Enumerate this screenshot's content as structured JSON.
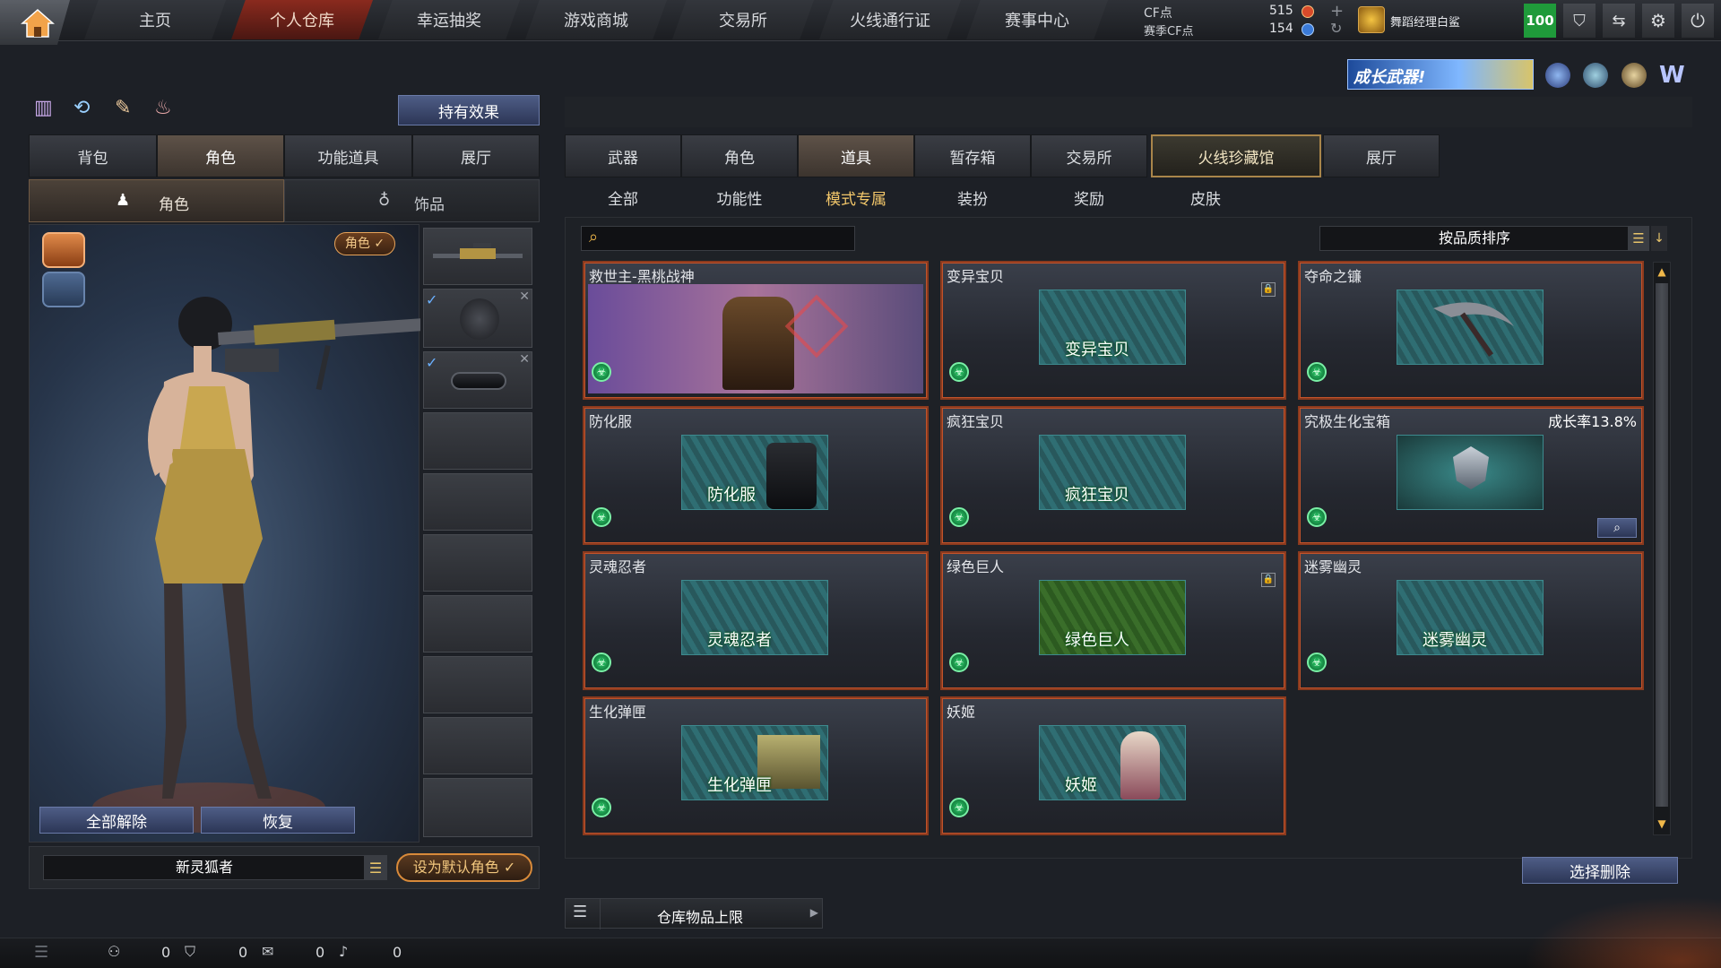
{
  "nav": {
    "items": [
      "主页",
      "个人仓库",
      "幸运抽奖",
      "游戏商城",
      "交易所",
      "火线通行证",
      "赛事中心"
    ],
    "active_index": 1
  },
  "currency": {
    "cf_label": "CF点",
    "cf_value": "515",
    "season_cf_label": "赛季CF点",
    "season_cf_value": "154"
  },
  "user": {
    "name": "舞蹈经理白鲨",
    "level": "100"
  },
  "banner": {
    "text": "成长武器!"
  },
  "left": {
    "effects_button": "持有效果",
    "tabs": [
      "背包",
      "角色",
      "功能道具",
      "展厅"
    ],
    "selected_tab": 1,
    "subtabs": [
      "角色",
      "饰品"
    ],
    "character_badge": "角色 ✓",
    "unequip_all": "全部解除",
    "restore": "恢复",
    "character_name": "新灵狐者",
    "set_default": "设为默认角色 ✓"
  },
  "right": {
    "tabs": [
      "武器",
      "角色",
      "道具",
      "暂存箱",
      "交易所",
      "火线珍藏馆",
      "展厅"
    ],
    "selected_tab": 2,
    "subtabs": [
      "全部",
      "功能性",
      "模式专属",
      "装扮",
      "奖励",
      "皮肤"
    ],
    "selected_subtab": 2,
    "search_placeholder": "",
    "sort_label": "按品质排序",
    "items": [
      {
        "title": "救世主-黑桃战神",
        "thumb_label": "",
        "extra": ""
      },
      {
        "title": "变异宝贝",
        "thumb_label": "变异宝贝",
        "extra": ""
      },
      {
        "title": "夺命之镰",
        "thumb_label": "",
        "extra": ""
      },
      {
        "title": "防化服",
        "thumb_label": "防化服",
        "extra": ""
      },
      {
        "title": "疯狂宝贝",
        "thumb_label": "疯狂宝贝",
        "extra": ""
      },
      {
        "title": "究极生化宝箱",
        "thumb_label": "",
        "extra": "成长率13.8%"
      },
      {
        "title": "灵魂忍者",
        "thumb_label": "灵魂忍者",
        "extra": ""
      },
      {
        "title": "绿色巨人",
        "thumb_label": "绿色巨人",
        "extra": ""
      },
      {
        "title": "迷雾幽灵",
        "thumb_label": "迷雾幽灵",
        "extra": ""
      },
      {
        "title": "生化弹匣",
        "thumb_label": "生化弹匣",
        "extra": ""
      },
      {
        "title": "妖姬",
        "thumb_label": "妖姬",
        "extra": ""
      }
    ],
    "select_delete": "选择删除",
    "storage_limit": "仓库物品上限"
  },
  "status": {
    "counts": [
      "0",
      "0",
      "0",
      "0"
    ]
  }
}
